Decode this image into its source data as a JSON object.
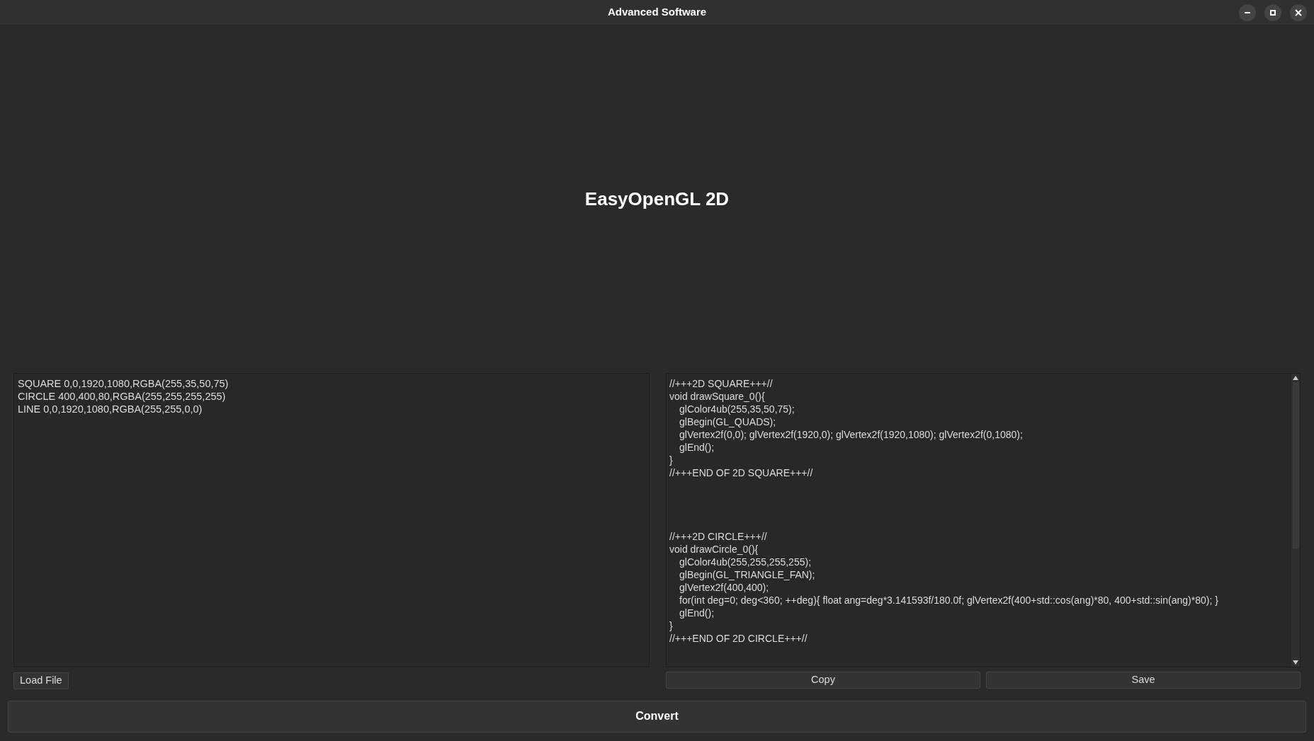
{
  "window": {
    "title": "Advanced Software"
  },
  "heading": "EasyOpenGL 2D",
  "input_editor": {
    "lines": [
      "SQUARE 0,0,1920,1080,RGBA(255,35,50,75)",
      "CIRCLE 400,400,80,RGBA(255,255,255,255)",
      "LINE 0,0,1920,1080,RGBA(255,255,0,0)"
    ]
  },
  "output_editor": {
    "blocks": [
      {
        "lines": [
          {
            "kind": "top",
            "text": "//+++2D SQUARE+++//"
          },
          {
            "kind": "top",
            "text": "void drawSquare_0(){"
          },
          {
            "kind": "body",
            "text": "glColor4ub(255,35,50,75);"
          },
          {
            "kind": "body",
            "text": "glBegin(GL_QUADS);"
          },
          {
            "kind": "body",
            "text": "glVertex2f(0,0); glVertex2f(1920,0); glVertex2f(1920,1080); glVertex2f(0,1080);"
          },
          {
            "kind": "body",
            "text": "glEnd();"
          },
          {
            "kind": "top",
            "text": "}"
          },
          {
            "kind": "top",
            "text": "//+++END OF 2D SQUARE+++//"
          }
        ]
      },
      {
        "lines": [
          {
            "kind": "top",
            "text": "//+++2D CIRCLE+++//"
          },
          {
            "kind": "top",
            "text": "void drawCircle_0(){"
          },
          {
            "kind": "body",
            "text": "glColor4ub(255,255,255,255);"
          },
          {
            "kind": "body",
            "text": "glBegin(GL_TRIANGLE_FAN);"
          },
          {
            "kind": "body",
            "text": "glVertex2f(400,400);"
          },
          {
            "kind": "body",
            "text": "for(int deg=0; deg<360; ++deg){ float ang=deg*3.141593f/180.0f; glVertex2f(400+std::cos(ang)*80, 400+std::sin(ang)*80); }"
          },
          {
            "kind": "body",
            "text": "glEnd();"
          },
          {
            "kind": "top",
            "text": "}"
          },
          {
            "kind": "top",
            "text": "//+++END OF 2D CIRCLE+++//"
          }
        ]
      }
    ]
  },
  "buttons": {
    "load": "Load File",
    "copy": "Copy",
    "save": "Save",
    "convert": "Convert"
  }
}
